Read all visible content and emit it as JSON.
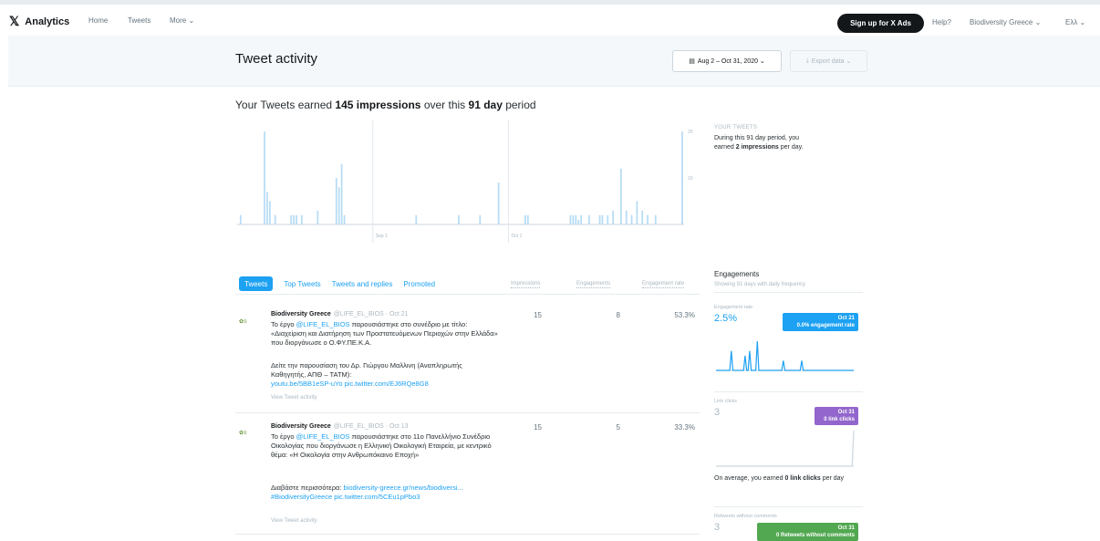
{
  "nav": {
    "brand": "Analytics",
    "links": [
      "Home",
      "Tweets",
      "More ⌄"
    ],
    "signup": "Sign up for X Ads",
    "help": "Help?",
    "account": "Biodiversity Greece ⌄",
    "lang": "Eλλ ⌄"
  },
  "header": {
    "title": "Tweet activity",
    "date_range": "Aug 2 – Oct 31, 2020 ⌄",
    "export": "Export data ⌄"
  },
  "summary": {
    "prefix": "Your Tweets earned ",
    "impressions": "145 impressions",
    "middle": " over this ",
    "days": "91 day",
    "suffix": " period"
  },
  "chart_data": {
    "type": "bar",
    "title": "",
    "x_labels": [
      "Sep 1",
      "Oct 1"
    ],
    "y_ticks": [
      20,
      10
    ],
    "ylim": [
      0,
      22
    ],
    "values": [
      0,
      2,
      0,
      0,
      0,
      0,
      0,
      0,
      0,
      0,
      20,
      7,
      5,
      0,
      2,
      0,
      0,
      0,
      0,
      0,
      2,
      2,
      2,
      0,
      2,
      0,
      0,
      0,
      0,
      0,
      3,
      0,
      0,
      0,
      0,
      0,
      0,
      10,
      8,
      13,
      2,
      0,
      0,
      0,
      0,
      0,
      0,
      0,
      0,
      0,
      0,
      0,
      0,
      0,
      0,
      0,
      0,
      0,
      0,
      0,
      0,
      0,
      0,
      0,
      0,
      0,
      0,
      2,
      0,
      0,
      0,
      0,
      0,
      0,
      0,
      0,
      0,
      0,
      0,
      0,
      0,
      0,
      0,
      2,
      0,
      0,
      0,
      0,
      0,
      0,
      0,
      2,
      0,
      0,
      0,
      0,
      0,
      0,
      9,
      0,
      0,
      0,
      0,
      0,
      0,
      0,
      0,
      0,
      2,
      2,
      0,
      0,
      0,
      0,
      0,
      0,
      0,
      0,
      0,
      0,
      0,
      0,
      0,
      0,
      0,
      2,
      2,
      2,
      1,
      2,
      0,
      0,
      2,
      0,
      0,
      0,
      2,
      2,
      0,
      2,
      0,
      3,
      0,
      0,
      12,
      0,
      3,
      0,
      2,
      0,
      5,
      0,
      3,
      0,
      2,
      0,
      0,
      2,
      0,
      0,
      0,
      0,
      0,
      0,
      0,
      0,
      0,
      20
    ]
  },
  "side": {
    "label": "YOUR TWEETS",
    "text_prefix": "During this 91 day period, you earned ",
    "bold": "2 impressions",
    "text_suffix": " per day."
  },
  "tabs": [
    "Tweets",
    "Top Tweets",
    "Tweets and replies",
    "Promoted"
  ],
  "columns": [
    "Impressions",
    "Engagements",
    "Engagement rate"
  ],
  "tweets": [
    {
      "name": "Biodiversity Greece",
      "handle": "@LIFE_EL_BIOS · Oct 21",
      "line1_pre": "Το έργο ",
      "mention": "@LIFE_EL_BIOS",
      "line1_post": " παρουσιάστηκε στο συνέδριο με τίτλο: «Διαχείριση και Διατήρηση των Προστατευόμενων Περιοχών στην Ελλάδα» που διοργάνωσε ο Ο.ΦΥ.ΠΕ.Κ.Α.",
      "para2": "Δείτε την παρουσίαση του Δρ. Γιώργου Μαλλινη (Αναπληρωτής Καθηγητής, ΑΠΘ – ΤΑΤΜ):",
      "link": "youtu.be/5BB1eSP-uYo pic.twitter.com/EJ6RQe8G8",
      "view": "View Tweet activity",
      "impressions": "15",
      "engagements": "8",
      "rate": "53.3%"
    },
    {
      "name": "Biodiversity Greece",
      "handle": "@LIFE_EL_BIOS · Oct 13",
      "line1_pre": "Το έργο ",
      "mention": "@LIFE_EL_BIOS",
      "line1_post": " παρουσιάστηκε στο 11ο Πανελλήνιο Συνέδριο Οικολογίας που διοργάνωσε η Ελληνική Οικολογική Εταιρεία, με κεντρικό θέμα: «Η Οικολογία στην Ανθρωπόκαινο Εποχή»",
      "para2": "Διαβάστε περισσότερα:",
      "link": "biodiversity-greece.gr/news/biodiversi... #BiodiversityGreece pic.twitter.com/5CEu1pPbo3",
      "view": "View Tweet activity",
      "impressions": "15",
      "engagements": "5",
      "rate": "33.3%"
    }
  ],
  "engagements": {
    "title": "Engagements",
    "sub": "Showing 91 days with daily frequency",
    "rate_label": "Engagement rate",
    "rate_value": "2.5%",
    "rate_tag_date": "Oct 21",
    "rate_tag": "0.0% engagement rate",
    "clicks_label": "Link clicks",
    "clicks_value": "3",
    "clicks_tag_date": "Oct 31",
    "clicks_tag": "0 link clicks",
    "note_prefix": "On average, you earned ",
    "note_bold": "0 link clicks",
    "note_suffix": " per day",
    "retweets_label": "Retweets without comments",
    "retweets_value": "3",
    "retweets_tag_date": "Oct 31",
    "retweets_tag": "0 Retweets without comments",
    "rate_spark": [
      0,
      0,
      0,
      0,
      0,
      0,
      0,
      0,
      0,
      0,
      4,
      0,
      0,
      0,
      0,
      0,
      0,
      0,
      0,
      3,
      0,
      0,
      4,
      0,
      0,
      0,
      0,
      6,
      0,
      0,
      0,
      0,
      0,
      0,
      0,
      0,
      0,
      0,
      0,
      0,
      0,
      0,
      0,
      0,
      2,
      0,
      0,
      0,
      0,
      0,
      0,
      0,
      0,
      0,
      0,
      0,
      2,
      0,
      0,
      0,
      0,
      0,
      0,
      0,
      0,
      0,
      0,
      0,
      0,
      0,
      0,
      0,
      0,
      0,
      0,
      0,
      0,
      0,
      0,
      0,
      0,
      0,
      0,
      0,
      0,
      0,
      0,
      0,
      0,
      0,
      0
    ],
    "clicks_spark": [
      0,
      0,
      0,
      0,
      0,
      0,
      0,
      0,
      0,
      0,
      0,
      0,
      0,
      0,
      0,
      0,
      0,
      0,
      0,
      0,
      0,
      0,
      0,
      0,
      0,
      0,
      0,
      0,
      0,
      0,
      0,
      0,
      0,
      0,
      0,
      0,
      0,
      0,
      0,
      0,
      0,
      0,
      0,
      0,
      0,
      0,
      0,
      0,
      0,
      0,
      0,
      0,
      0,
      0,
      0,
      0,
      0,
      0,
      0,
      0,
      0,
      0,
      0,
      0,
      0,
      0,
      0,
      0,
      0,
      0,
      0,
      0,
      0,
      0,
      0,
      0,
      0,
      0,
      0,
      0,
      0,
      0,
      0,
      0,
      0,
      0,
      0,
      0,
      0,
      0,
      3
    ]
  },
  "colors": {
    "accent": "#1da1f2",
    "bar": "#b7dcf5",
    "purple": "#9266cc",
    "green": "#52a850"
  }
}
